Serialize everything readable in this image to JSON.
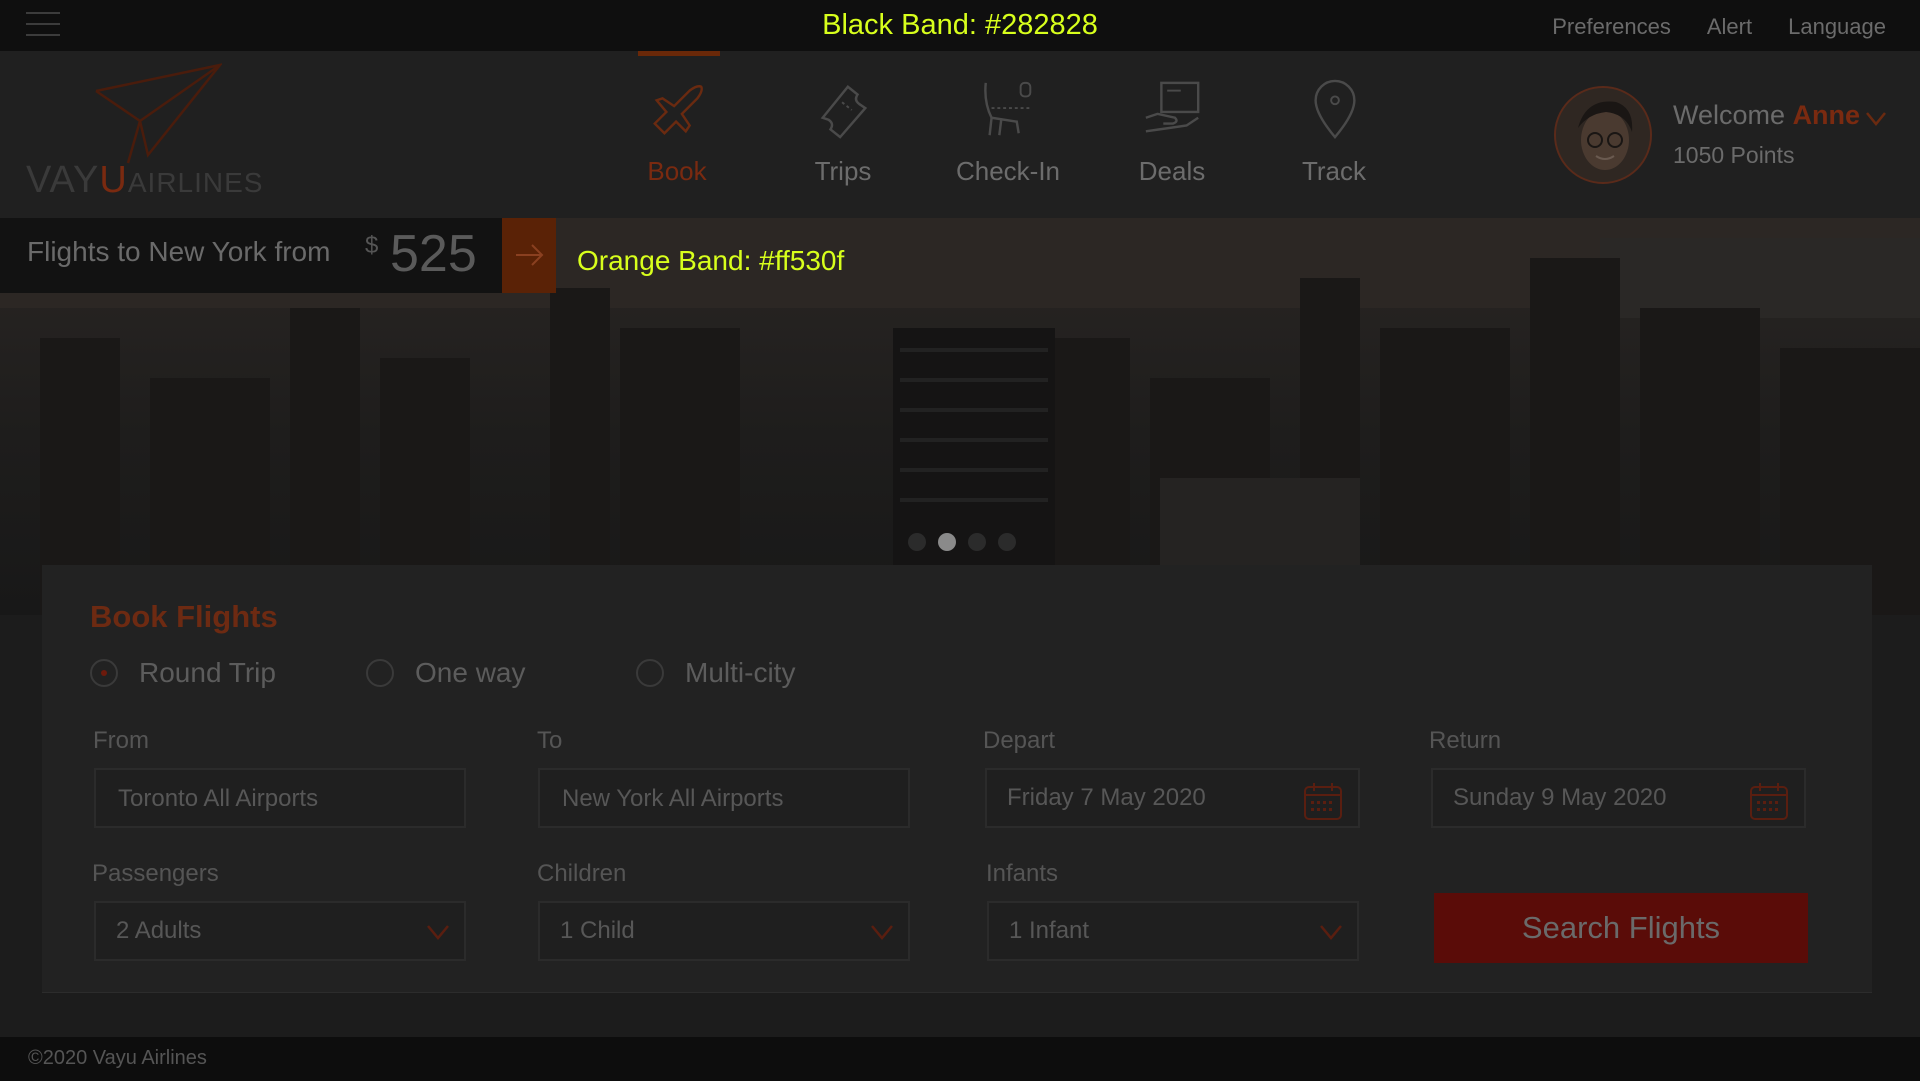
{
  "topbar": {
    "band_title": "Black Band: #282828",
    "links": [
      "Preferences",
      "Alert",
      "Language"
    ]
  },
  "logo": {
    "part1": "VAY",
    "part2": "U",
    "part3": "AIRLINES"
  },
  "nav": {
    "items": [
      {
        "label": "Book",
        "icon": "plane-icon",
        "active": true
      },
      {
        "label": "Trips",
        "icon": "ticket-icon"
      },
      {
        "label": "Check-In",
        "icon": "seat-icon"
      },
      {
        "label": "Deals",
        "icon": "hand-card-icon"
      },
      {
        "label": "Track",
        "icon": "location-pin-icon"
      }
    ]
  },
  "user": {
    "welcome": "Welcome",
    "name": "Anne",
    "points": "1050 Points"
  },
  "hero": {
    "promo_text": "Flights to New York from",
    "currency": "$",
    "price": "525",
    "band_label": "Orange Band: #ff530f",
    "slides": 4,
    "active_slide": 2
  },
  "booking": {
    "title": "Book Flights",
    "trip_types": [
      "Round Trip",
      "One way",
      "Multi-city"
    ],
    "selected_trip": "Round Trip",
    "from_label": "From",
    "from_value": "Toronto All Airports",
    "to_label": "To",
    "to_value": "New York All Airports",
    "depart_label": "Depart",
    "depart_value": "Friday  7  May 2020",
    "return_label": "Return",
    "return_value": "Sunday  9 May 2020",
    "passengers_label": "Passengers",
    "passengers_value": "2 Adults",
    "children_label": "Children",
    "children_value": "1 Child",
    "infants_label": "Infants",
    "infants_value": "1 Infant",
    "search_button": "Search Flights"
  },
  "footer": {
    "copyright": "©2020 Vayu Airlines"
  },
  "colors": {
    "black_band": "#282828",
    "orange_band": "#ff530f",
    "accent_label": "#d8ff1c"
  }
}
